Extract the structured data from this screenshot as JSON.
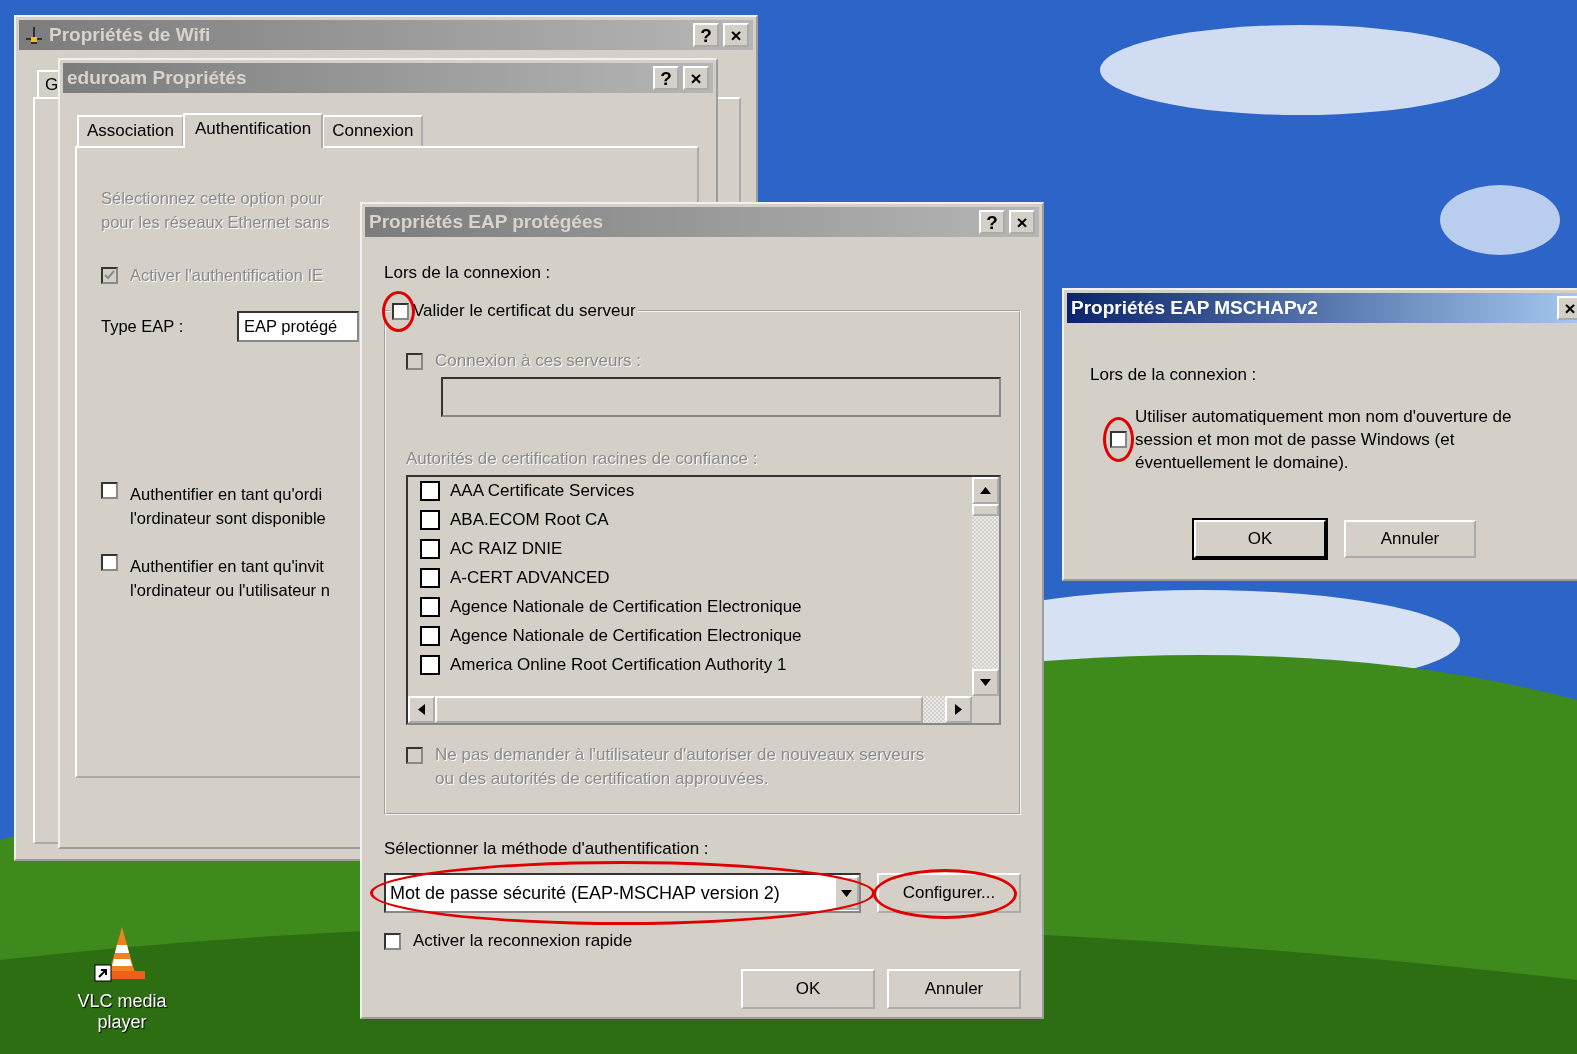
{
  "desktop": {
    "icons": [
      {
        "label": "VLC media player"
      }
    ]
  },
  "wifi_window": {
    "title": "Propriétés de Wifi",
    "active": false,
    "help_button": "?",
    "close_button": "×",
    "tabs": [
      {
        "label": "G",
        "selected": false
      }
    ]
  },
  "eduroam_window": {
    "title": "eduroam Propriétés",
    "active": false,
    "help_button": "?",
    "close_button": "×",
    "tabs": [
      {
        "label": "Association",
        "selected": false
      },
      {
        "label": "Authentification",
        "selected": true
      },
      {
        "label": "Connexion",
        "selected": false
      }
    ],
    "description": [
      "Sélectionnez cette option pour",
      "pour les réseaux Ethernet sans"
    ],
    "enable_auth": {
      "label": "Activer l'authentification IE",
      "checked": true,
      "disabled": true
    },
    "eap_type": {
      "label": "Type EAP :",
      "value": "EAP protégé"
    },
    "options": [
      {
        "lines": [
          "Authentifier en tant qu'ordi",
          "l'ordinateur sont disponible"
        ],
        "checked": false
      },
      {
        "lines": [
          "Authentifier en tant qu'invit",
          "l'ordinateur ou l'utilisateur n"
        ],
        "checked": false
      }
    ]
  },
  "peap_window": {
    "title": "Propriétés EAP protégées",
    "active": false,
    "help_button": "?",
    "close_button": "×",
    "connection_label": "Lors de la connexion :",
    "validate_cert": {
      "label": "Valider le certificat du serveur",
      "checked": false,
      "annotated": true
    },
    "connect_servers": {
      "label": "Connexion à ces serveurs :",
      "checked": false,
      "disabled": true
    },
    "ca_label": "Autorités de certification racines de confiance :",
    "ca_list": [
      {
        "name": "AAA Certificate Services",
        "checked": false
      },
      {
        "name": "ABA.ECOM Root CA",
        "checked": false
      },
      {
        "name": "AC RAIZ DNIE",
        "checked": false
      },
      {
        "name": "A-CERT ADVANCED",
        "checked": false
      },
      {
        "name": "Agence Nationale de Certification Electronique",
        "checked": false
      },
      {
        "name": "Agence Nationale de Certification Electronique",
        "checked": false
      },
      {
        "name": "America Online Root Certification Authority 1",
        "checked": false
      }
    ],
    "no_prompt": {
      "label": "Ne pas demander à l'utilisateur d'autoriser de nouveaux serveurs ou des autorités de certification approuvées.",
      "checked": false,
      "disabled": true
    },
    "method_label": "Sélectionner la méthode d'authentification :",
    "method": {
      "value": "Mot de passe sécurité (EAP-MSCHAP version 2)",
      "annotated": true
    },
    "configure_button": {
      "label": "Configurer...",
      "annotated": true
    },
    "fast_reconnect": {
      "label": "Activer la reconnexion rapide",
      "checked": false
    },
    "buttons": [
      {
        "label": "OK",
        "default": false
      },
      {
        "label": "Annuler",
        "default": false
      }
    ]
  },
  "mschap_window": {
    "title": "Propriétés EAP MSCHAPv2",
    "active": true,
    "close_button": "×",
    "connection_label": "Lors de la connexion :",
    "auto_logon": {
      "label": "Utiliser automatiquement mon nom d'ouverture de session et mon mot de passe Windows (et éventuellement le domaine).",
      "checked": false,
      "annotated": true
    },
    "buttons": [
      {
        "label": "OK",
        "default": true
      },
      {
        "label": "Annuler",
        "default": false
      }
    ]
  }
}
